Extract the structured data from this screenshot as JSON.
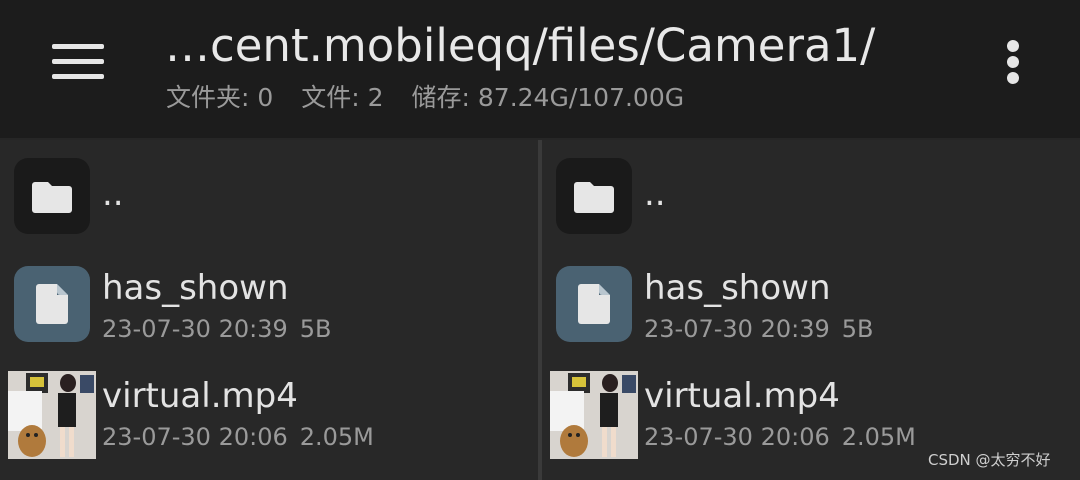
{
  "header": {
    "path": "…cent.mobileqq/files/Camera1/",
    "folders_label": "文件夹:",
    "folders_count": "0",
    "files_label": "文件:",
    "files_count": "2",
    "storage_label": "储存:",
    "storage_value": "87.24G/107.00G",
    "menu_icon": "hamburger-menu-icon",
    "more_icon": "more-vertical-icon"
  },
  "panes": [
    {
      "items": [
        {
          "name": "..",
          "type": "folder",
          "icon": "folder-icon"
        },
        {
          "name": "has_shown",
          "type": "file",
          "icon": "file-icon",
          "date": "23-07-30 20:39",
          "size": "5B"
        },
        {
          "name": "virtual.mp4",
          "type": "video",
          "icon": "video-thumbnail",
          "date": "23-07-30 20:06",
          "size": "2.05M"
        }
      ]
    },
    {
      "items": [
        {
          "name": "..",
          "type": "folder",
          "icon": "folder-icon"
        },
        {
          "name": "has_shown",
          "type": "file",
          "icon": "file-icon",
          "date": "23-07-30 20:39",
          "size": "5B"
        },
        {
          "name": "virtual.mp4",
          "type": "video",
          "icon": "video-thumbnail",
          "date": "23-07-30 20:06",
          "size": "2.05M"
        }
      ]
    }
  ],
  "watermark": "CSDN @太穷不好",
  "colors": {
    "header_bg": "#1c1c1c",
    "pane_bg": "#282828",
    "folder_icon_bg": "#1a1a1a",
    "file_icon_bg": "#4a6272",
    "icon_fg": "#e6e6e6"
  }
}
